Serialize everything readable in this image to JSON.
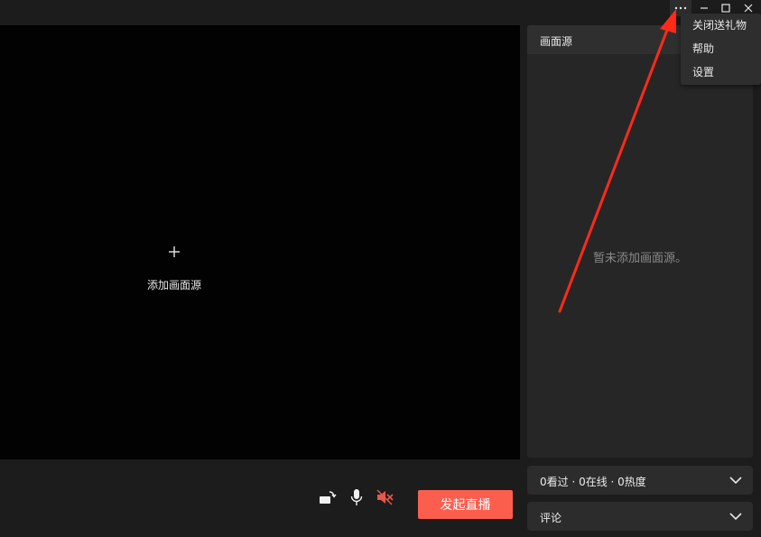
{
  "window": {
    "more_icon": "more-horizontal-icon",
    "minimize_icon": "minimize-icon",
    "maximize_icon": "maximize-icon",
    "close_icon": "close-icon"
  },
  "menu": {
    "items": [
      "关闭送礼物",
      "帮助",
      "设置"
    ]
  },
  "preview": {
    "add_source_label": "添加画面源",
    "icon": "plus-icon"
  },
  "sources_panel": {
    "title": "画面源",
    "empty_text": "暂未添加画面源。"
  },
  "controls": {
    "rotate_icon": "screen-rotate-icon",
    "mic_icon": "microphone-icon",
    "speaker_icon": "speaker-muted-icon",
    "start_label": "发起直播"
  },
  "stats": {
    "label": "0看过 · 0在线 · 0热度"
  },
  "comments": {
    "label": "评论"
  },
  "colors": {
    "accent": "#fc5e4e",
    "muted_speaker": "#e9574a",
    "annotation_arrow": "#ff2a1a",
    "background": "#1c1c1c",
    "preview": "#020202"
  }
}
